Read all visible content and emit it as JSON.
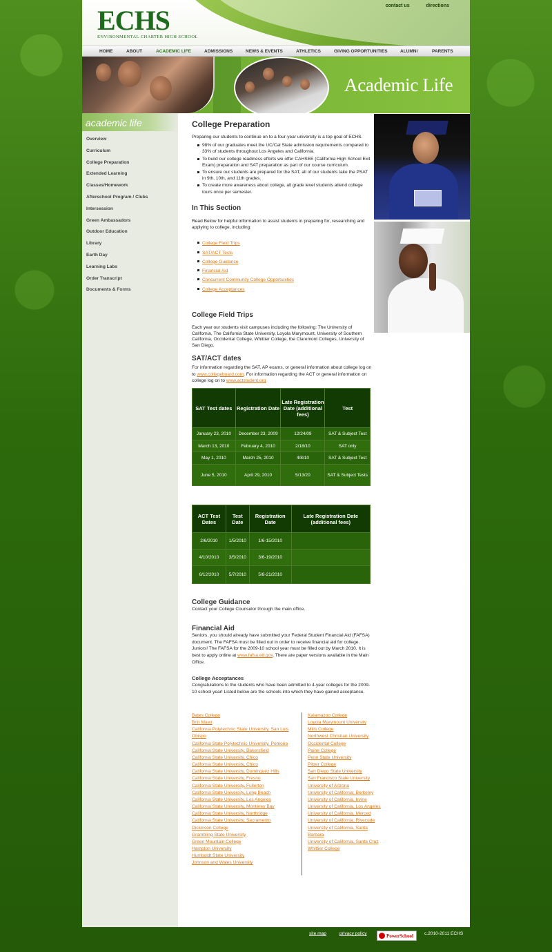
{
  "header": {
    "logo_mark": "ECHS",
    "logo_sub": "ENVIRONMENTAL CHARTER HIGH SCHOOL",
    "contact_us": "contact us",
    "directions": "directions"
  },
  "nav": [
    "HOME",
    "ABOUT",
    "ACADEMIC LIFE",
    "ADMISSIONS",
    "NEWS & EVENTS",
    "ATHLETICS",
    "GIVING OPPORTUNITIES",
    "ALUMNI",
    "PARENTS"
  ],
  "banner": {
    "title": "Academic Life"
  },
  "sidebar": {
    "heading": "academic life",
    "items": [
      "Overview",
      "Curriculum",
      "College Preparation",
      "Extended Learning",
      "Classes/Homework",
      "Afterschool Program / Clubs",
      "Intersession",
      "Green Ambassadors",
      "Outdoor Education",
      "Library",
      "Earth Day",
      "Learning Labs",
      "Order Transcript",
      "Documents & Forms"
    ]
  },
  "main": {
    "title": "College Preparation",
    "intro": "Preparing our students to continue on to a four-year university is a top goal of ECHS.",
    "bullets": [
      "98% of our graduates meet the UC/Cal State admission requirements compared to 33% of students throughout Los Angeles and California.",
      "To build our college readiness efforts we offer CAHSEE (California High School Exit Exam) preparation and SAT preparation as part of our course curriculum.",
      "To ensure our students are prepared for the SAT, all of our students take the PSAT in 9th, 10th, and 11th grades.",
      "To create more awareness about college, all grade level students attend college tours once per semester."
    ],
    "section_title": "In This Section",
    "section_intro": "Read Below for helpful information to assist students in preparing for, researching and applying to college, including:",
    "section_links": [
      "College Field Trips",
      "SAT/ACT Tests",
      "College Guidance",
      "Financial Aid",
      "Concurrent Community College Opportunities",
      "College Acceptances"
    ],
    "field_trips_title": "College Field Trips",
    "field_trips_text": "Each year our students visit campuses including the following:  The University of California, The California State University, Loyola Marymount, University of Southern California, Occidental College, Whittier College, the Claremont Colleges, University of San Diego.",
    "sat_title": "SAT/ACT dates",
    "sat_text_1": "For information regarding the SAT, AP exams, or general information about college log on to ",
    "sat_link_1": "www.collegeboard.com",
    "sat_text_2": ".  For information regarding the ACT or general information on college log on to ",
    "sat_link_2": "www.actstudent.org",
    "guidance_title": "College Guidance",
    "guidance_text": "Contact your College Counselor through the main office.",
    "aid_title": "Financial Aid",
    "aid_text_1": "Seniors, you should already have submitted your Federal Student Financial Aid (FAFSA) document.  The FAFSA must be filled out in order to receive financial aid for college.  Juniors!  The FAFSA for the 2009-10 school year must be filled out by March 2010.  It is best to apply online at ",
    "aid_link": "www.fafsa.ed.gov",
    "aid_text_2": ".  There are paper versions available in the Main Office.",
    "accept_title": "College Acceptances",
    "accept_text": "Congratulations to the students who have been admitted to 4-year colleges for the 2009-10 school year!  Listed below are the schools into which they have gained acceptance."
  },
  "sat_table": {
    "headers": [
      "SAT Test dates",
      "Registration Date",
      "Late Registration Date (additional fees)",
      "Test"
    ],
    "rows": [
      [
        "January 23, 2010",
        "December 23, 2009",
        "12/24/09",
        "SAT & Subject Test"
      ],
      [
        "March 13, 2010",
        "February 4, 2010",
        "2/18/10",
        "SAT only"
      ],
      [
        "May 1, 2010",
        "March 25, 2010",
        "4/8/10",
        "SAT & Subject Test"
      ],
      [
        "June 5, 2010",
        "April 29, 2010",
        "5/13/20",
        "SAT & Subject Tests"
      ]
    ]
  },
  "act_table": {
    "headers": [
      "ACT Test Dates",
      "Test Date",
      "Registration Date",
      "Late Registration Date (additional fees)"
    ],
    "rows": [
      [
        "2/6/2010",
        "1/5/2010",
        "1/6-15/2010",
        ""
      ],
      [
        "4/10/2010",
        "3/5/2010",
        "3/6-19/2010",
        ""
      ],
      [
        "6/12/2010",
        "5/7/2010",
        "5/8-21/2010",
        ""
      ]
    ]
  },
  "colleges_left": [
    "Bates College",
    "Brin Mawr",
    "California Polytechnic State University, San Luis Obispo",
    "California State Polytechnic University, Pomona",
    "California State University, Bakersfield",
    "California State University, Chico",
    "California State University, Chico",
    "California State University, Dominguez Hills",
    "California State University, Fresno",
    "California State University, Fullerton",
    "California State University, Long Beach",
    "California State University, Los Angeles",
    "California State University, Monterey Bay",
    "California State University, Northridge",
    "California State University, Sacramento",
    "Dickinson College",
    "Grambling State University",
    "Green Mountain College",
    "Hampton University",
    "Humboldt State University",
    "Johnson and Wales University"
  ],
  "colleges_right": [
    "Kalamazoo College",
    "Loyola Marymount University",
    "Mills College",
    "Northwest Christian University",
    "Occidental College",
    "Paine College",
    "Penn State University",
    "Pitzer College",
    "San Diego State University",
    "San Francisco State University",
    "University of Arizona",
    "University of California, Berkeley",
    "University of California, Irvine",
    "University of California, Los Angeles",
    "University of California, Merced",
    "University of California, Riverside",
    "University of California, Santa Barbara",
    "University of California, Santa Cruz",
    "Whittier College"
  ],
  "footer": {
    "site_map": "site map",
    "privacy": "privacy policy",
    "powerschool": "PowerSchool",
    "copyright": "c.2010-2011 ECHS"
  }
}
